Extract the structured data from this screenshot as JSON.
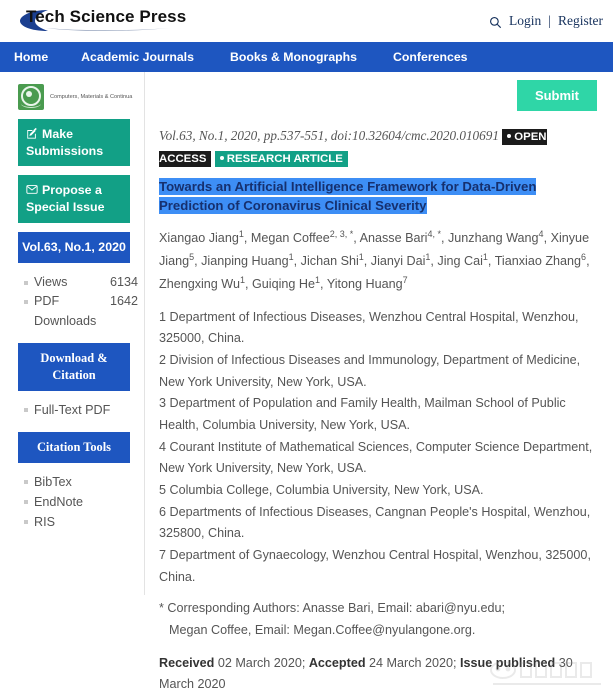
{
  "header": {
    "brand": "Tech Science Press",
    "search_icon": "search-icon",
    "login": "Login",
    "separator": "|",
    "register": "Register"
  },
  "nav": {
    "items": [
      {
        "label": "Home"
      },
      {
        "label": "Academic Journals"
      },
      {
        "label": "Books & Monographs"
      },
      {
        "label": "Conferences"
      }
    ]
  },
  "sidebar": {
    "journal": {
      "badge_icon": "journal-emblem-icon",
      "name": "Computers, Materials & Continua"
    },
    "buttons": [
      {
        "label": "Make Submissions",
        "icon": "pencil-square-icon",
        "style": "teal"
      },
      {
        "label": "Propose a Special Issue",
        "icon": "envelope-icon",
        "style": "teal"
      }
    ],
    "volume_button": "Vol.63, No.1, 2020",
    "stats": [
      {
        "label": "Views",
        "value": "6134"
      },
      {
        "label": "PDF Downloads",
        "value": "1642"
      }
    ],
    "download_heading": "Download & Citation",
    "download_links": [
      {
        "label": "Full-Text PDF"
      }
    ],
    "citation_heading": "Citation Tools",
    "citation_links": [
      {
        "label": "BibTex"
      },
      {
        "label": "EndNote"
      },
      {
        "label": "RIS"
      }
    ]
  },
  "content": {
    "submit_label": "Submit",
    "meta_line": "Vol.63, No.1, 2020, pp.537-551, doi:10.32604/cmc.2020.010691",
    "badges": [
      {
        "label": "OPEN ACCESS",
        "style": "dark"
      },
      {
        "label": "RESEARCH ARTICLE",
        "style": "teal"
      }
    ],
    "title": "Towards an Artificial Intelligence Framework for Data-Driven Prediction of Coronavirus Clinical Severity",
    "title_selected": true,
    "authors": [
      {
        "name": "Xiangao Jiang",
        "sup": "1"
      },
      {
        "name": "Megan Coffee",
        "sup": "2, 3, *"
      },
      {
        "name": "Anasse Bari",
        "sup": "4, *"
      },
      {
        "name": "Junzhang Wang",
        "sup": "4"
      },
      {
        "name": "Xinyue Jiang",
        "sup": "5"
      },
      {
        "name": "Jianping Huang",
        "sup": "1"
      },
      {
        "name": "Jichan Shi",
        "sup": "1"
      },
      {
        "name": "Jianyi Dai",
        "sup": "1"
      },
      {
        "name": "Jing Cai",
        "sup": "1"
      },
      {
        "name": "Tianxiao Zhang",
        "sup": "6"
      },
      {
        "name": "Zhengxing Wu",
        "sup": "1"
      },
      {
        "name": "Guiqing He",
        "sup": "1"
      },
      {
        "name": "Yitong Huang",
        "sup": "7"
      }
    ],
    "affiliations": [
      "1 Department of Infectious Diseases, Wenzhou Central Hospital, Wenzhou, 325000, China.",
      "2 Division of Infectious Diseases and Immunology, Department of Medicine, New York University, New York, USA.",
      "3 Department of Population and Family Health, Mailman School of Public Health, Columbia University, New York, USA.",
      "4 Courant Institute of Mathematical Sciences, Computer Science Department, New York University, New York, USA.",
      "5 Columbia College, Columbia University, New York, USA.",
      "6 Departments of Infectious Diseases, Cangnan People's Hospital, Wenzhou, 325800, China.",
      "7 Department of Gynaecology, Wenzhou Central Hospital, Wenzhou, 325000, China."
    ],
    "corresponding_line1": "* Corresponding Authors: Anasse Bari, Email: abari@nyu.edu;",
    "corresponding_line2": "Megan Coffee, Email: Megan.Coffee@nyulangone.org.",
    "dates": {
      "received_label": "Received",
      "received_value": "02 March 2020;",
      "accepted_label": "Accepted",
      "accepted_value": "24 March 2020;",
      "published_label": "Issue published",
      "published_value": "30 March 2020"
    }
  },
  "colors": {
    "nav_blue": "#1e56c0",
    "teal": "#12a086",
    "submit_mint": "#2fd6a7",
    "selection_blue": "#3d8ef5",
    "badge_dark": "#1b1b1b",
    "journal_green": "#4a9b4f"
  }
}
